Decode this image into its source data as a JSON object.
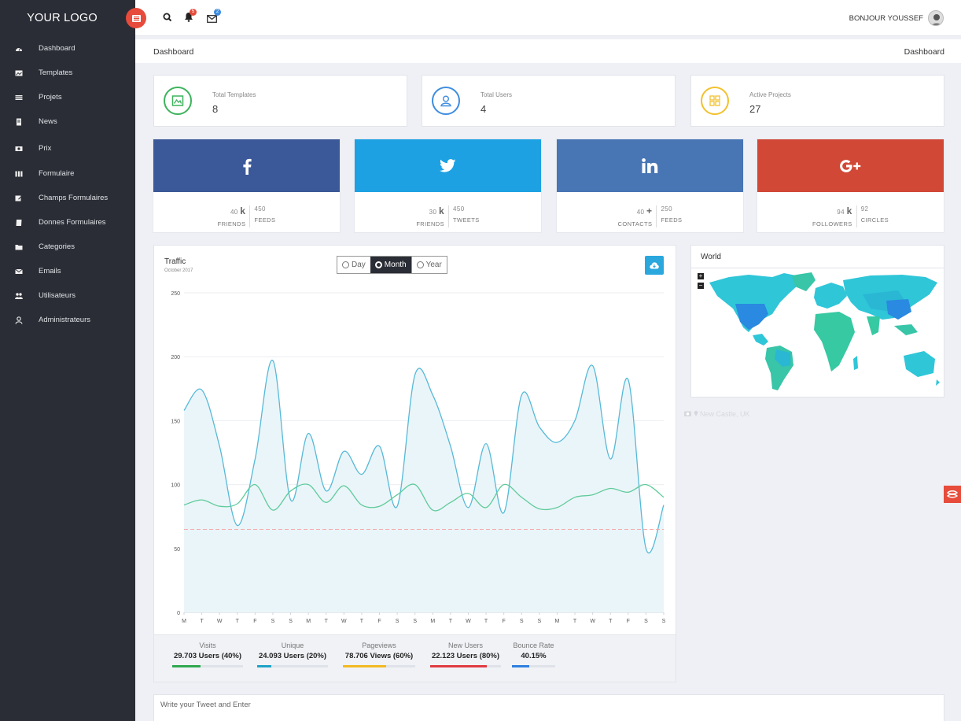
{
  "app": {
    "logo": "YOUR LOGO"
  },
  "sidebar": {
    "items": [
      {
        "label": "Dashboard",
        "icon": "dashboard-icon"
      },
      {
        "label": "Templates",
        "icon": "image-icon"
      },
      {
        "label": "Projets",
        "icon": "list-icon"
      },
      {
        "label": "News",
        "icon": "document-icon"
      },
      {
        "label": "Prix",
        "icon": "money-icon"
      },
      {
        "label": "Formulaire",
        "icon": "columns-icon"
      },
      {
        "label": "Champs Formulaires",
        "icon": "edit-icon"
      },
      {
        "label": "Donnes Formulaires",
        "icon": "book-icon"
      },
      {
        "label": "Categories",
        "icon": "folder-icon"
      },
      {
        "label": "Emails",
        "icon": "envelope-icon"
      },
      {
        "label": "Utilisateurs",
        "icon": "users-icon"
      },
      {
        "label": "Administrateurs",
        "icon": "user-icon"
      }
    ]
  },
  "topbar": {
    "notifications_badge": "5",
    "messages_badge": "2",
    "greeting": "BONJOUR YOUSSEF"
  },
  "breadcrumb": {
    "left": "Dashboard",
    "right": "Dashboard"
  },
  "stats": [
    {
      "label": "Total Templates",
      "value": "8",
      "color": "#3cb35c",
      "icon": "image-icon"
    },
    {
      "label": "Total Users",
      "value": "4",
      "color": "#3e8de0",
      "icon": "user-icon"
    },
    {
      "label": "Active Projects",
      "value": "27",
      "color": "#f2c12e",
      "icon": "grid-icon"
    }
  ],
  "social": [
    {
      "network": "facebook",
      "color": "#3b5998",
      "left_num": "40",
      "left_suffix": "k",
      "left_label": "FRIENDS",
      "right_num": "450",
      "right_label": "FEEDS"
    },
    {
      "network": "twitter",
      "color": "#1da1e2",
      "left_num": "30",
      "left_suffix": "k",
      "left_label": "FRIENDS",
      "right_num": "450",
      "right_label": "TWEETS"
    },
    {
      "network": "linkedin",
      "color": "#4875b4",
      "left_num": "40",
      "left_suffix": "+",
      "left_label": "CONTACTS",
      "right_num": "250",
      "right_label": "FEEDS"
    },
    {
      "network": "google-plus",
      "color": "#d14836",
      "left_num": "94",
      "left_suffix": "k",
      "left_label": "FOLLOWERS",
      "right_num": "92",
      "right_label": "CIRCLES"
    }
  ],
  "traffic": {
    "title": "Traffic",
    "subtitle": "October 2017",
    "options": [
      "Day",
      "Month",
      "Year"
    ],
    "selected": "Month"
  },
  "metrics": [
    {
      "label": "Visits",
      "value": "29.703 Users (40%)",
      "percent": 40,
      "color": "#2fa84f"
    },
    {
      "label": "Unique",
      "value": "24.093 Users (20%)",
      "percent": 20,
      "color": "#1ea3c6"
    },
    {
      "label": "Pageviews",
      "value": "78.706 Views (60%)",
      "percent": 60,
      "color": "#f3b921"
    },
    {
      "label": "New Users",
      "value": "22.123 Users (80%)",
      "percent": 80,
      "color": "#e13b42"
    },
    {
      "label": "Bounce Rate",
      "value": "40.15%",
      "percent": 40.15,
      "color": "#2f80e0"
    }
  ],
  "world": {
    "title": "World",
    "caption": "New Castle, UK"
  },
  "tweet": {
    "placeholder": "Write your Tweet and Enter"
  },
  "chart_data": {
    "type": "area",
    "categories": [
      "M",
      "T",
      "W",
      "T",
      "F",
      "S",
      "S",
      "M",
      "T",
      "W",
      "T",
      "F",
      "S",
      "S",
      "M",
      "T",
      "W",
      "T",
      "F",
      "S",
      "S",
      "M",
      "T",
      "W",
      "T",
      "F",
      "S",
      "S"
    ],
    "ylim": [
      0,
      250
    ],
    "yticks": [
      0,
      50,
      100,
      150,
      200,
      250
    ],
    "grid": true,
    "series": [
      {
        "color": "#56b9d8",
        "fill": "#eaf5f9",
        "values": [
          158,
          174,
          130,
          68,
          120,
          197,
          88,
          140,
          95,
          126,
          108,
          130,
          83,
          186,
          170,
          130,
          82,
          132,
          78,
          170,
          145,
          133,
          150,
          193,
          120,
          182,
          50,
          84
        ]
      },
      {
        "color": "#5fcb9a",
        "values": [
          84,
          88,
          83,
          85,
          100,
          80,
          95,
          100,
          86,
          99,
          84,
          83,
          92,
          100,
          80,
          86,
          93,
          82,
          100,
          90,
          81,
          82,
          90,
          92,
          97,
          94,
          100,
          90
        ]
      }
    ],
    "threshold": {
      "value": 65,
      "color": "#f5a7a7"
    }
  }
}
